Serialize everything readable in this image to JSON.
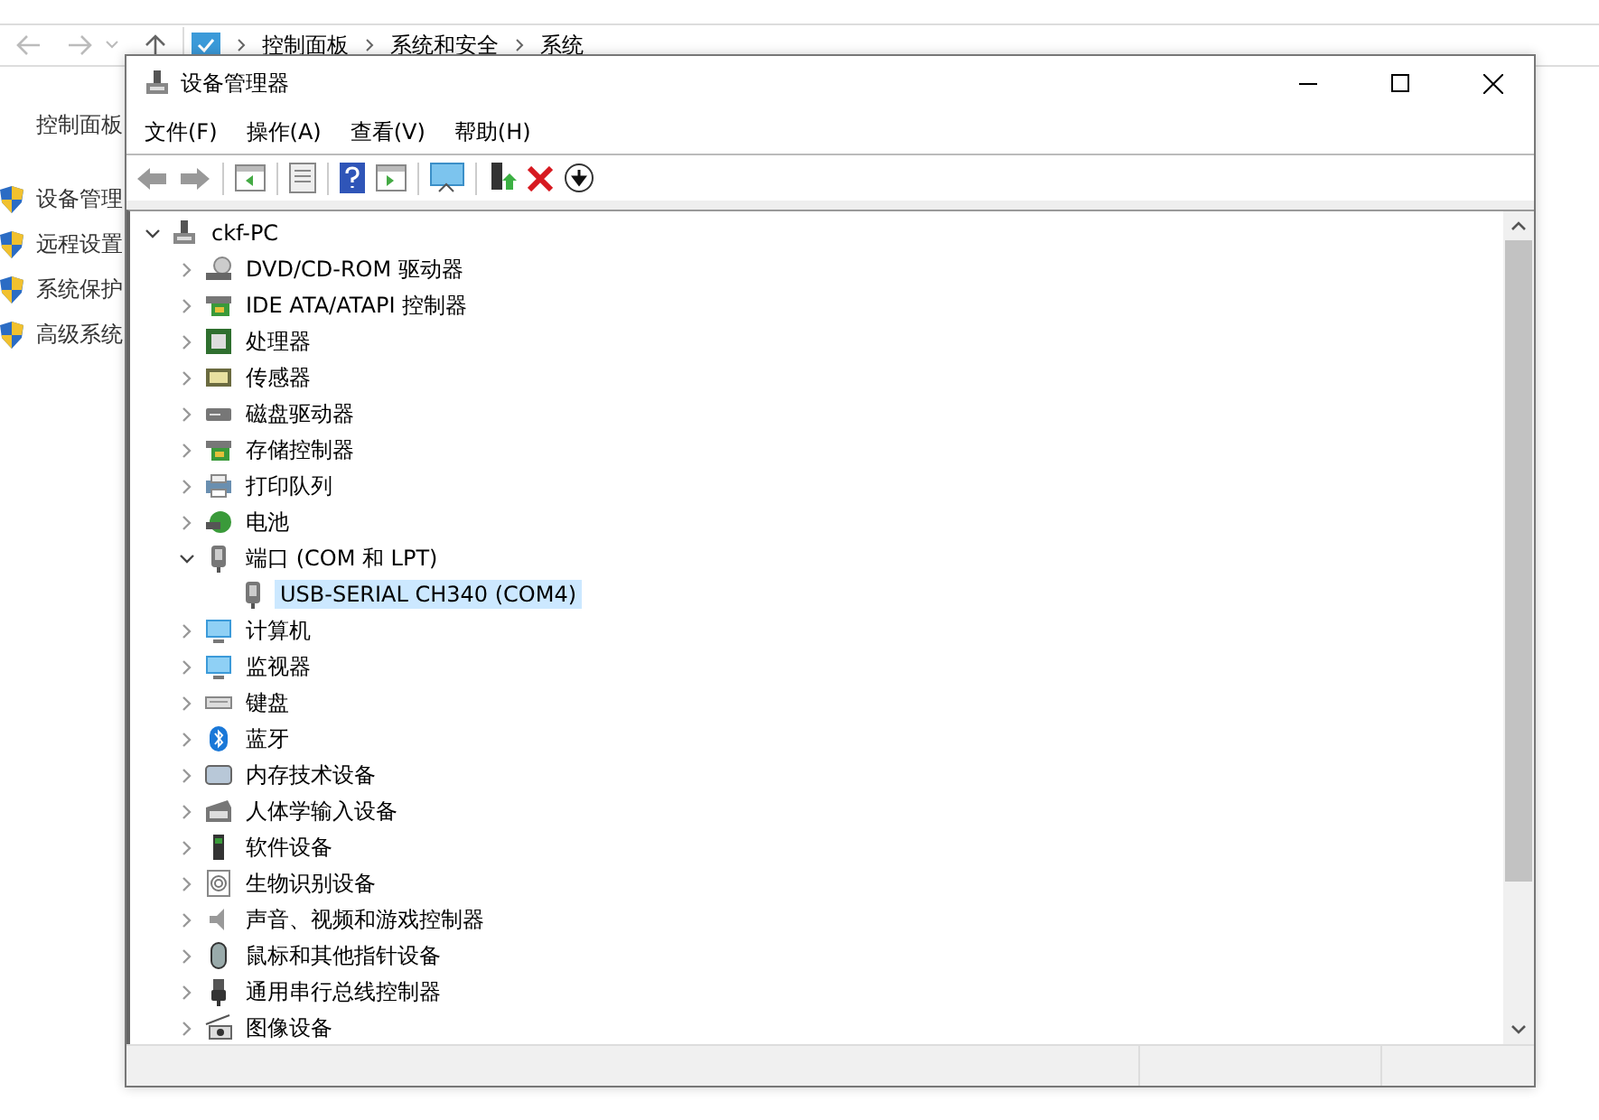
{
  "background_window": {
    "breadcrumb": [
      "控制面板",
      "系统和安全",
      "系统"
    ],
    "side_title": "控制面板",
    "links": [
      "设备管理",
      "远程设置",
      "系统保护",
      "高级系统"
    ]
  },
  "dialog": {
    "title": "设备管理器",
    "menu": [
      "文件(F)",
      "操作(A)",
      "查看(V)",
      "帮助(H)"
    ],
    "tree": {
      "label": "ckf-PC",
      "kind": "computer",
      "expanded": true,
      "selected": false,
      "children": [
        {
          "label": "DVD/CD-ROM 驱动器",
          "kind": "disc",
          "expanded": false,
          "selected": false
        },
        {
          "label": "IDE ATA/ATAPI 控制器",
          "kind": "controller",
          "expanded": false,
          "selected": false
        },
        {
          "label": "处理器",
          "kind": "chip",
          "expanded": false,
          "selected": false
        },
        {
          "label": "传感器",
          "kind": "sensor",
          "expanded": false,
          "selected": false
        },
        {
          "label": "磁盘驱动器",
          "kind": "drive",
          "expanded": false,
          "selected": false
        },
        {
          "label": "存储控制器",
          "kind": "controller",
          "expanded": false,
          "selected": false
        },
        {
          "label": "打印队列",
          "kind": "printer",
          "expanded": false,
          "selected": false
        },
        {
          "label": "电池",
          "kind": "battery",
          "expanded": false,
          "selected": false
        },
        {
          "label": "端口 (COM 和 LPT)",
          "kind": "port",
          "expanded": true,
          "selected": false,
          "children": [
            {
              "label": "USB-SERIAL CH340 (COM4)",
              "kind": "port",
              "selected": true
            }
          ]
        },
        {
          "label": "计算机",
          "kind": "monitor",
          "expanded": false,
          "selected": false
        },
        {
          "label": "监视器",
          "kind": "monitor",
          "expanded": false,
          "selected": false
        },
        {
          "label": "键盘",
          "kind": "keyboard",
          "expanded": false,
          "selected": false
        },
        {
          "label": "蓝牙",
          "kind": "bluetooth",
          "expanded": false,
          "selected": false
        },
        {
          "label": "内存技术设备",
          "kind": "memory",
          "expanded": false,
          "selected": false
        },
        {
          "label": "人体学输入设备",
          "kind": "hid",
          "expanded": false,
          "selected": false
        },
        {
          "label": "软件设备",
          "kind": "tower",
          "expanded": false,
          "selected": false
        },
        {
          "label": "生物识别设备",
          "kind": "fingerprint",
          "expanded": false,
          "selected": false
        },
        {
          "label": "声音、视频和游戏控制器",
          "kind": "speaker",
          "expanded": false,
          "selected": false
        },
        {
          "label": "鼠标和其他指针设备",
          "kind": "mouse",
          "expanded": false,
          "selected": false
        },
        {
          "label": "通用串行总线控制器",
          "kind": "usb",
          "expanded": false,
          "selected": false
        },
        {
          "label": "图像设备",
          "kind": "camera",
          "expanded": false,
          "selected": false
        }
      ]
    }
  }
}
